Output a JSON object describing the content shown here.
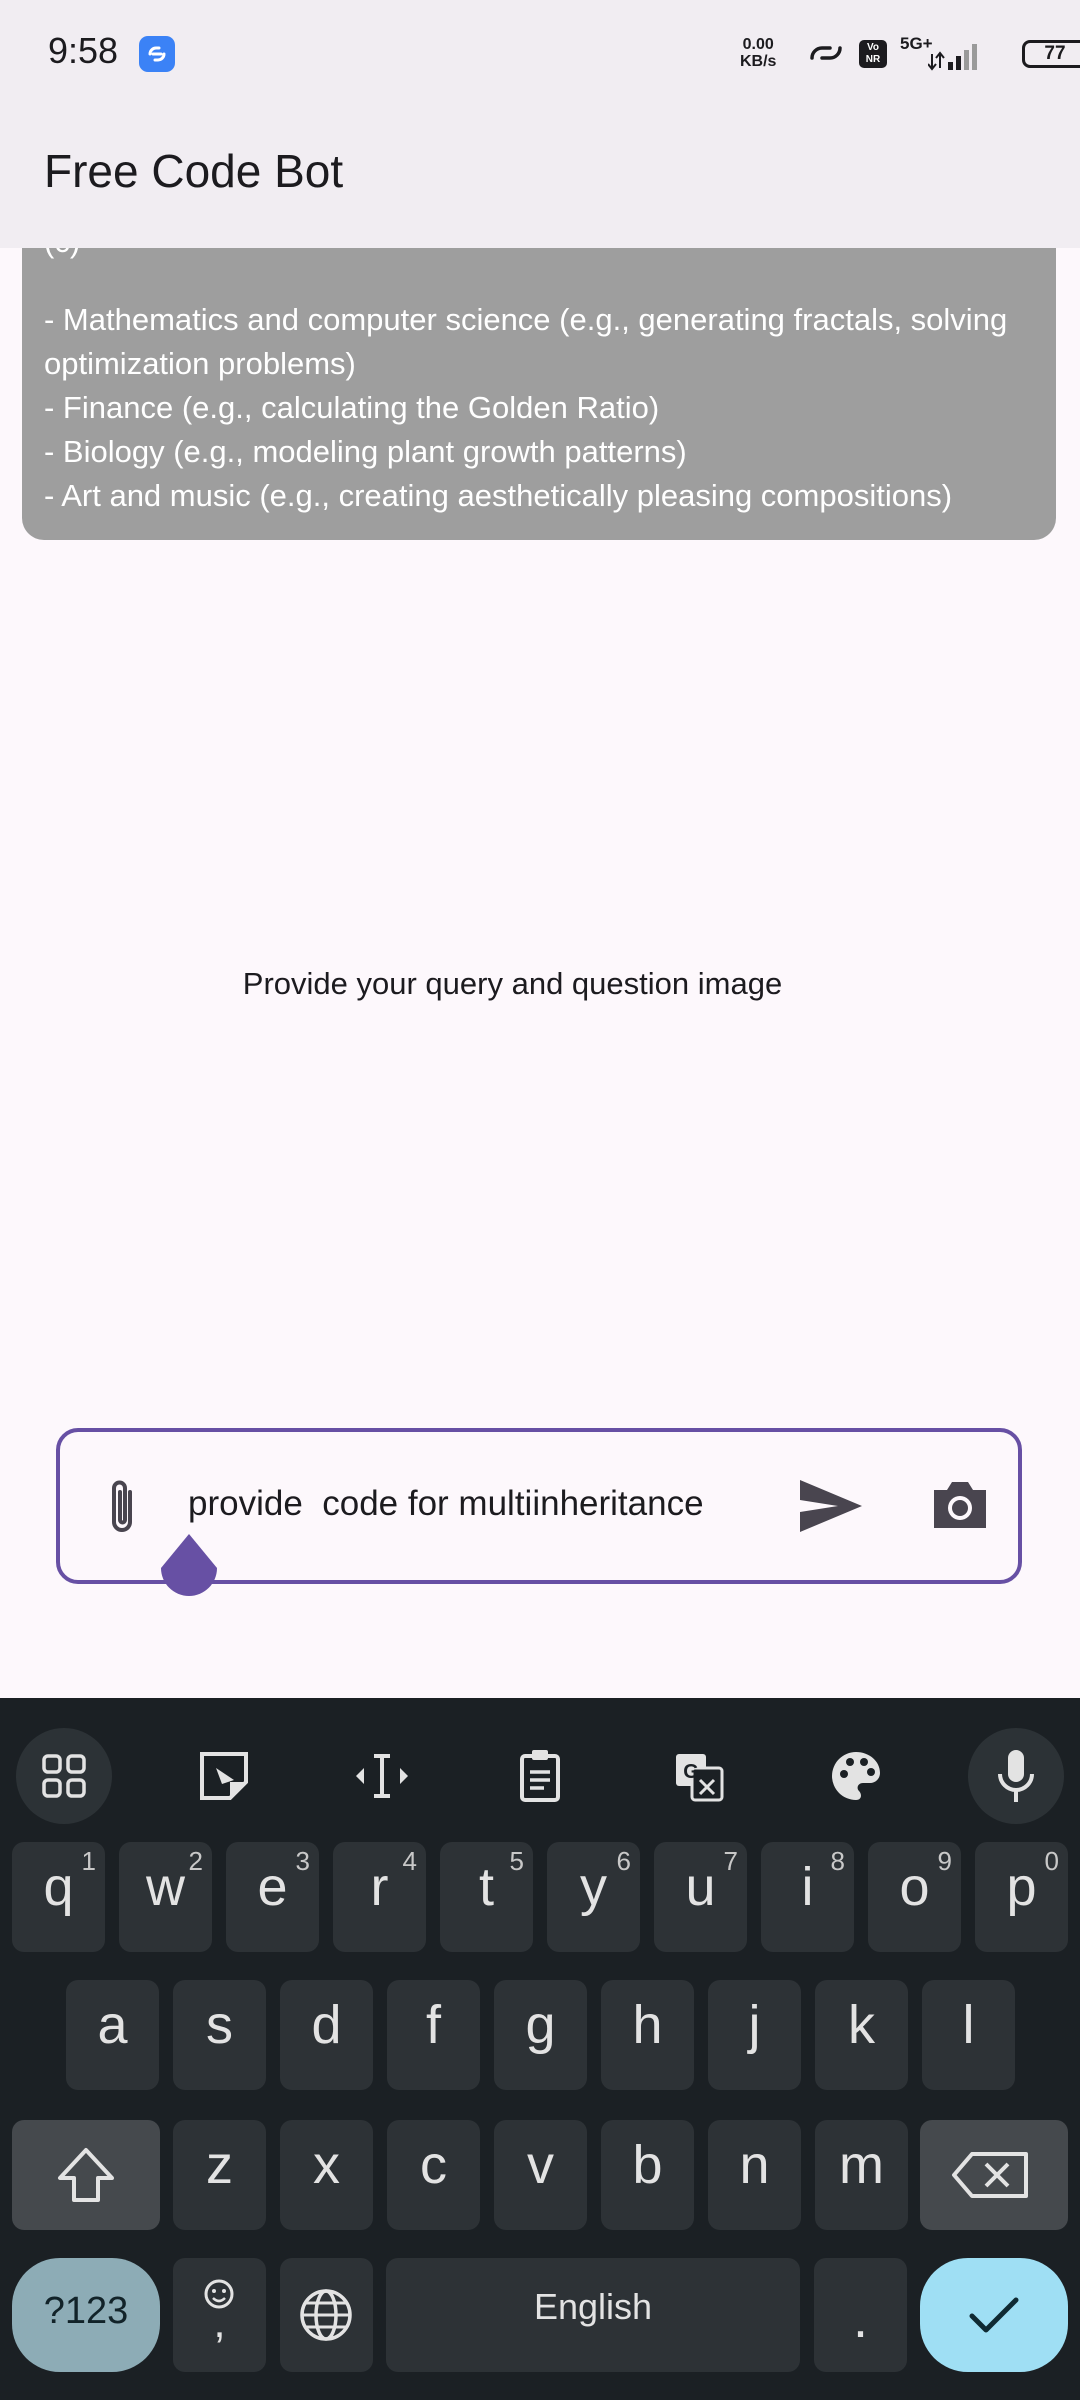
{
  "status_bar": {
    "time": "9:58",
    "net_speed_value": "0.00",
    "net_speed_unit": "KB/s",
    "network_type": "5G+",
    "volte": "Vo NR",
    "battery": "77"
  },
  "app": {
    "title": "Free Code Bot"
  },
  "chat": {
    "clipped_line": "(c)",
    "lines": [
      "- Mathematics and computer science (e.g., generating fractals, solving optimization problems)",
      "- Finance (e.g., calculating the Golden Ratio)",
      "- Biology (e.g., modeling plant growth patterns)",
      "- Art and music (e.g., creating aesthetically pleasing compositions)"
    ]
  },
  "hint": "Provide your query and question image",
  "input": {
    "value": "provide  code for multiinheritance"
  },
  "keyboard": {
    "row1": [
      {
        "k": "q",
        "n": "1"
      },
      {
        "k": "w",
        "n": "2"
      },
      {
        "k": "e",
        "n": "3"
      },
      {
        "k": "r",
        "n": "4"
      },
      {
        "k": "t",
        "n": "5"
      },
      {
        "k": "y",
        "n": "6"
      },
      {
        "k": "u",
        "n": "7"
      },
      {
        "k": "i",
        "n": "8"
      },
      {
        "k": "o",
        "n": "9"
      },
      {
        "k": "p",
        "n": "0"
      }
    ],
    "row2": [
      "a",
      "s",
      "d",
      "f",
      "g",
      "h",
      "j",
      "k",
      "l"
    ],
    "row3": [
      "z",
      "x",
      "c",
      "v",
      "b",
      "n",
      "m"
    ],
    "symbols_key": "?123",
    "comma_key": ",",
    "space_label": "English",
    "period_key": "."
  },
  "colors": {
    "accent": "#6750a4",
    "keyboard_bg": "#1b2024",
    "enter_key": "#9fdff4"
  }
}
